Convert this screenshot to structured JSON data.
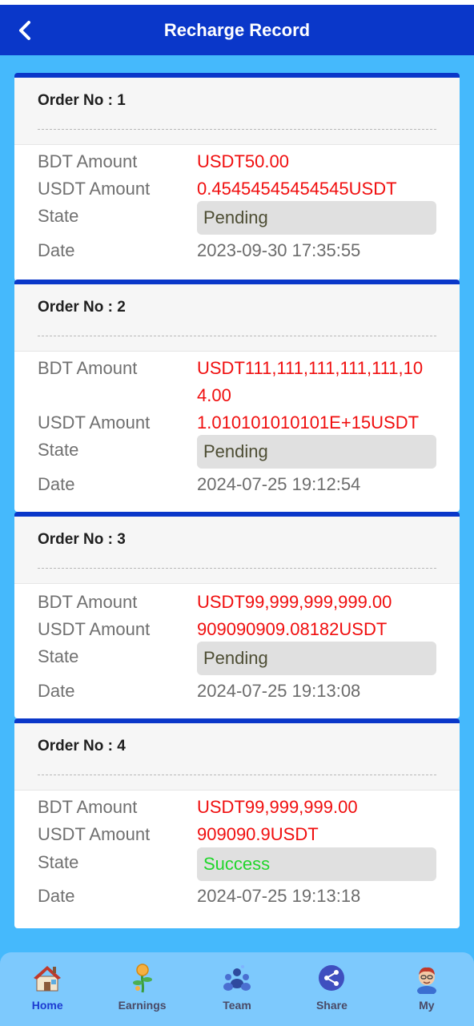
{
  "header": {
    "title": "Recharge Record",
    "back_icon": "chevron-left-icon"
  },
  "labels": {
    "bdt": "BDT Amount",
    "usdt": "USDT Amount",
    "state": "State",
    "date": "Date"
  },
  "orders": [
    {
      "order_no": "Order No : 1",
      "bdt_amount": "USDT50.00",
      "usdt_amount": "0.45454545454545USDT",
      "state": "Pending",
      "date": "2023-09-30 17:35:55"
    },
    {
      "order_no": "Order No : 2",
      "bdt_amount": "USDT111,111,111,111,111,104.00",
      "usdt_amount": "1.010101010101E+15USDT",
      "state": "Pending",
      "date": "2024-07-25 19:12:54"
    },
    {
      "order_no": "Order No : 3",
      "bdt_amount": "USDT99,999,999,999.00",
      "usdt_amount": "909090909.08182USDT",
      "state": "Pending",
      "date": "2024-07-25 19:13:08"
    },
    {
      "order_no": "Order No : 4",
      "bdt_amount": "USDT99,999,999.00",
      "usdt_amount": "909090.9USDT",
      "state": "Success",
      "date": "2024-07-25 19:13:18"
    }
  ],
  "nav": {
    "items": [
      {
        "label": "Home",
        "icon": "home-icon",
        "active": true
      },
      {
        "label": "Earnings",
        "icon": "earnings-icon"
      },
      {
        "label": "Team",
        "icon": "team-icon"
      },
      {
        "label": "Share",
        "icon": "share-icon"
      },
      {
        "label": "My",
        "icon": "avatar-icon"
      }
    ]
  },
  "colors": {
    "header": "#0a37c9",
    "background": "#45b9fc",
    "amount": "#f00e0e",
    "success": "#21d62b",
    "nav_active": "#1d3bd1"
  }
}
